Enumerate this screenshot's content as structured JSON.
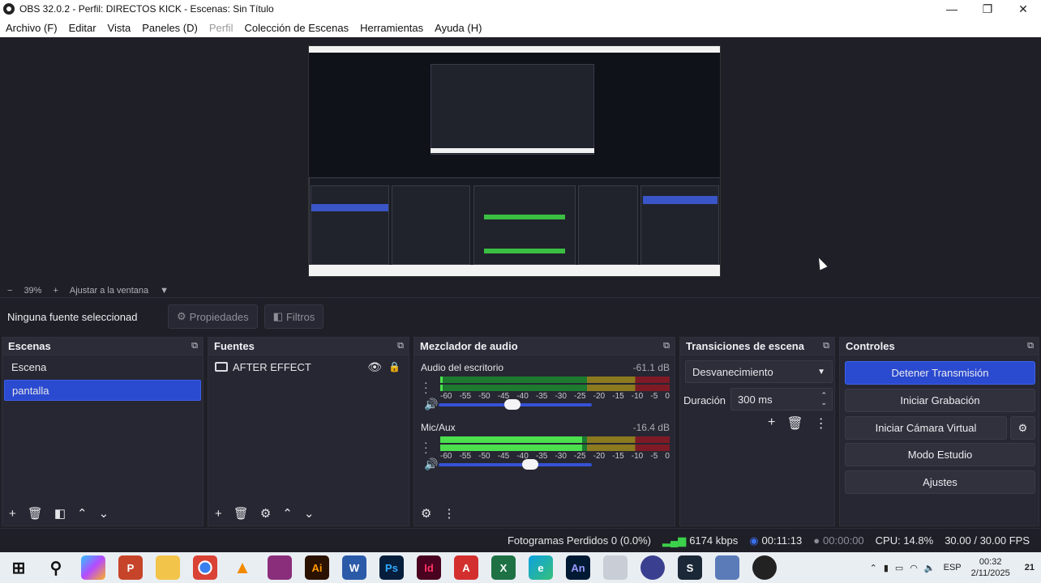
{
  "window": {
    "title": "OBS 32.0.2 - Perfil: DIRECTOS KICK - Escenas: Sin Título",
    "minimize": "—",
    "restore": "❐",
    "close": "✕"
  },
  "menu": [
    "Archivo (F)",
    "Editar",
    "Vista",
    "Paneles (D)",
    "Perfil",
    "Colección de Escenas",
    "Herramientas",
    "Ayuda (H)"
  ],
  "zoom": {
    "minus": "−",
    "value": "39%",
    "plus": "+",
    "fit": "Ajustar a la ventana",
    "arrow": "▼"
  },
  "source_toolbar": {
    "no_selection": "Ninguna fuente seleccionad",
    "properties": "Propiedades",
    "filters": "Filtros"
  },
  "scenes": {
    "title": "Escenas",
    "items": [
      "Escena",
      "pantalla"
    ],
    "selected": "pantalla"
  },
  "sources": {
    "title": "Fuentes",
    "items": [
      "AFTER EFFECT"
    ]
  },
  "mixer": {
    "title": "Mezclador de audio",
    "ticks": [
      "-60",
      "-55",
      "-50",
      "-45",
      "-40",
      "-35",
      "-30",
      "-25",
      "-20",
      "-15",
      "-10",
      "-5",
      "0"
    ],
    "channels": [
      {
        "name": "Audio del escritorio",
        "db": "-61.1 dB",
        "level": 0.01,
        "volume": 0.48
      },
      {
        "name": "Mic/Aux",
        "db": "-16.4 dB",
        "level": 0.62,
        "volume": 0.6
      }
    ]
  },
  "transitions": {
    "title": "Transiciones de escena",
    "selected": "Desvanecimiento",
    "duration_label": "Duración",
    "duration_value": "300 ms"
  },
  "controls": {
    "title": "Controles",
    "stop_stream": "Detener Transmisión",
    "start_record": "Iniciar Grabación",
    "virtual_cam": "Iniciar Cámara Virtual",
    "studio_mode": "Modo Estudio",
    "settings": "Ajustes"
  },
  "status": {
    "dropped_frames": "Fotogramas Perdidos 0 (0.0%)",
    "bitrate": "6174 kbps",
    "stream_time": "00:11:13",
    "record_time": "00:00:00",
    "cpu": "CPU: 14.8%",
    "fps": "30.00 / 30.00 FPS"
  },
  "taskbar": {
    "lang": "ESP",
    "time": "00:32",
    "date": "2/11/2025",
    "notifications": "21"
  },
  "colors": {
    "accent": "#2a4ad0",
    "panel": "#262732",
    "bg": "#1f1f27",
    "meter_green": "#4ce04e"
  }
}
